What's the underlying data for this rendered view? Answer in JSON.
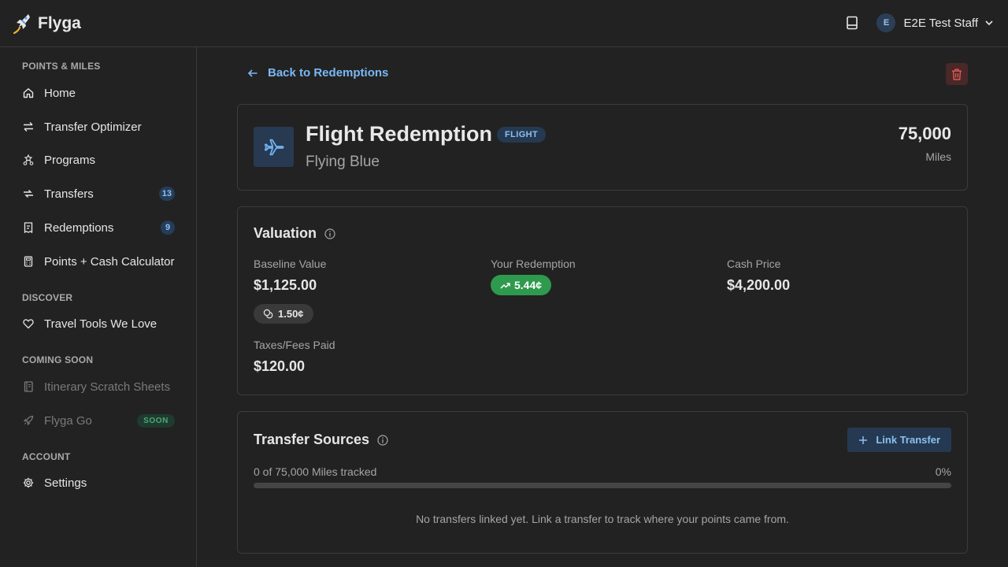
{
  "app": {
    "name": "Flyga"
  },
  "user": {
    "initial": "E",
    "name": "E2E Test Staff"
  },
  "sidebar": {
    "sections": [
      {
        "title": "POINTS & MILES"
      },
      {
        "title": "DISCOVER"
      },
      {
        "title": "COMING SOON"
      },
      {
        "title": "ACCOUNT"
      }
    ],
    "items": [
      {
        "label": "Home",
        "icon": "home-icon"
      },
      {
        "label": "Transfer Optimizer",
        "icon": "swap-icon"
      },
      {
        "label": "Programs",
        "icon": "stars-icon"
      },
      {
        "label": "Transfers",
        "icon": "transfer-icon",
        "count": "13"
      },
      {
        "label": "Redemptions",
        "icon": "receipt-icon",
        "count": "9"
      },
      {
        "label": "Points + Cash Calculator",
        "icon": "calculator-icon"
      },
      {
        "label": "Travel Tools We Love",
        "icon": "heart-icon"
      },
      {
        "label": "Itinerary Scratch Sheets",
        "icon": "notebook-icon"
      },
      {
        "label": "Flyga Go",
        "icon": "rocket-icon",
        "badge": "SOON"
      },
      {
        "label": "Settings",
        "icon": "gear-icon"
      }
    ]
  },
  "main": {
    "back_label": "Back to Redemptions",
    "header": {
      "title": "Flight Redemption",
      "type_badge": "FLIGHT",
      "program": "Flying Blue",
      "amount": "75,000",
      "unit": "Miles"
    },
    "valuation": {
      "title": "Valuation",
      "baseline_label": "Baseline Value",
      "baseline_value": "$1,125.00",
      "baseline_cpp": "1.50¢",
      "your_label": "Your Redemption",
      "your_cpp": "5.44¢",
      "cash_label": "Cash Price",
      "cash_value": "$4,200.00",
      "taxes_label": "Taxes/Fees Paid",
      "taxes_value": "$120.00"
    },
    "transfer_sources": {
      "title": "Transfer Sources",
      "link_label": "Link Transfer",
      "progress_text": "0 of 75,000 Miles tracked",
      "progress_pct": "0%",
      "progress_fraction": 0,
      "empty_message": "No transfers linked yet. Link a transfer to track where your points came from."
    }
  },
  "colors": {
    "accent": "#7ab8f5",
    "success": "#2e9a4d",
    "danger": "#e05a5a",
    "background": "#222222"
  }
}
